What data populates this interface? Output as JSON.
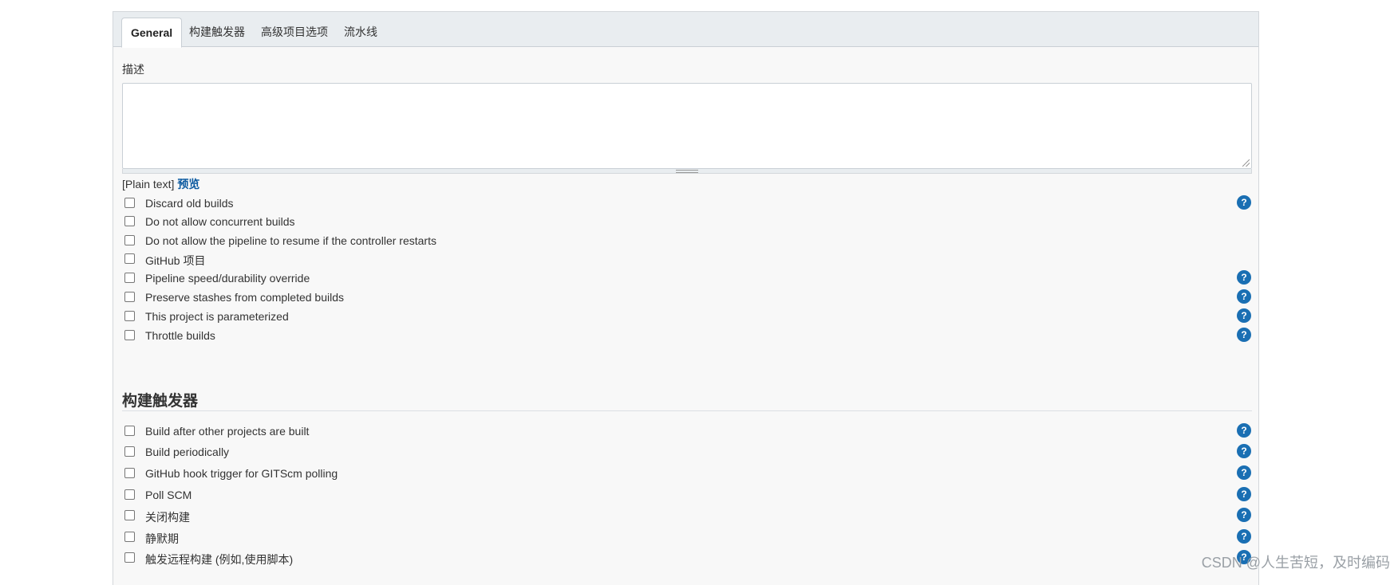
{
  "tabs": [
    {
      "label": "General",
      "active": true
    },
    {
      "label": "构建触发器",
      "active": false
    },
    {
      "label": "高级项目选项",
      "active": false
    },
    {
      "label": "流水线",
      "active": false
    }
  ],
  "description": {
    "label": "描述",
    "value": "",
    "format_text": "[Plain text]",
    "preview_link": "预览"
  },
  "general_options": [
    {
      "label": "Discard old builds",
      "checked": false,
      "help": true
    },
    {
      "label": "Do not allow concurrent builds",
      "checked": false,
      "help": false
    },
    {
      "label": "Do not allow the pipeline to resume if the controller restarts",
      "checked": false,
      "help": false
    },
    {
      "label": "GitHub 项目",
      "checked": false,
      "help": false
    },
    {
      "label": "Pipeline speed/durability override",
      "checked": false,
      "help": true
    },
    {
      "label": "Preserve stashes from completed builds",
      "checked": false,
      "help": true
    },
    {
      "label": "This project is parameterized",
      "checked": false,
      "help": true
    },
    {
      "label": "Throttle builds",
      "checked": false,
      "help": true
    }
  ],
  "triggers_section": {
    "title": "构建触发器",
    "options": [
      {
        "label": "Build after other projects are built",
        "checked": false,
        "help": true
      },
      {
        "label": "Build periodically",
        "checked": false,
        "help": true
      },
      {
        "label": "GitHub hook trigger for GITScm polling",
        "checked": false,
        "help": true
      },
      {
        "label": "Poll SCM",
        "checked": false,
        "help": true
      },
      {
        "label": "关闭构建",
        "checked": false,
        "help": true
      },
      {
        "label": "静默期",
        "checked": false,
        "help": true
      },
      {
        "label": "触发远程构建 (例如,使用脚本)",
        "checked": false,
        "help": true
      }
    ]
  },
  "help_icon_glyph": "?",
  "watermark": "CSDN @人生苦短，及时编码"
}
